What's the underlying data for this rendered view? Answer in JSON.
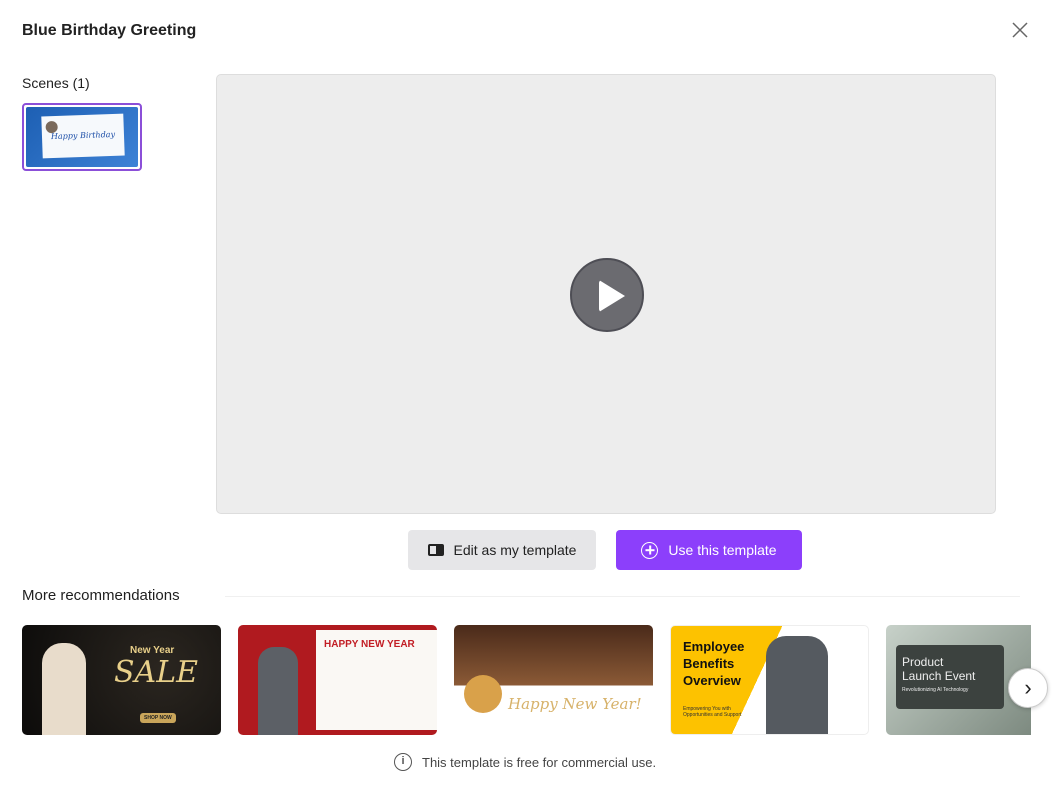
{
  "dialog": {
    "title": "Blue Birthday Greeting"
  },
  "scenes": {
    "label": "Scenes (1)",
    "items": [
      {
        "thumb_text": "Happy Birthday"
      }
    ]
  },
  "actions": {
    "edit_label": "Edit as my template",
    "use_label": "Use this template"
  },
  "recommendations": {
    "title": "More recommendations",
    "items": [
      {
        "line1": "New Year",
        "line2": "SALE",
        "cta": "SHOP NOW"
      },
      {
        "line1": "HAPPY NEW YEAR"
      },
      {
        "line1": "Happy New Year!"
      },
      {
        "line1": "Employee",
        "line2": "Benefits",
        "line3": "Overview",
        "sub": "Empowering You with Opportunities and Support"
      },
      {
        "line1": "Product",
        "line2": "Launch Event",
        "sub": "Revolutionizing AI Technology"
      }
    ]
  },
  "footer": {
    "note": "This template is free for commercial use."
  },
  "colors": {
    "accent": "#8c3ffb",
    "selected_border": "#8b4fd8"
  }
}
